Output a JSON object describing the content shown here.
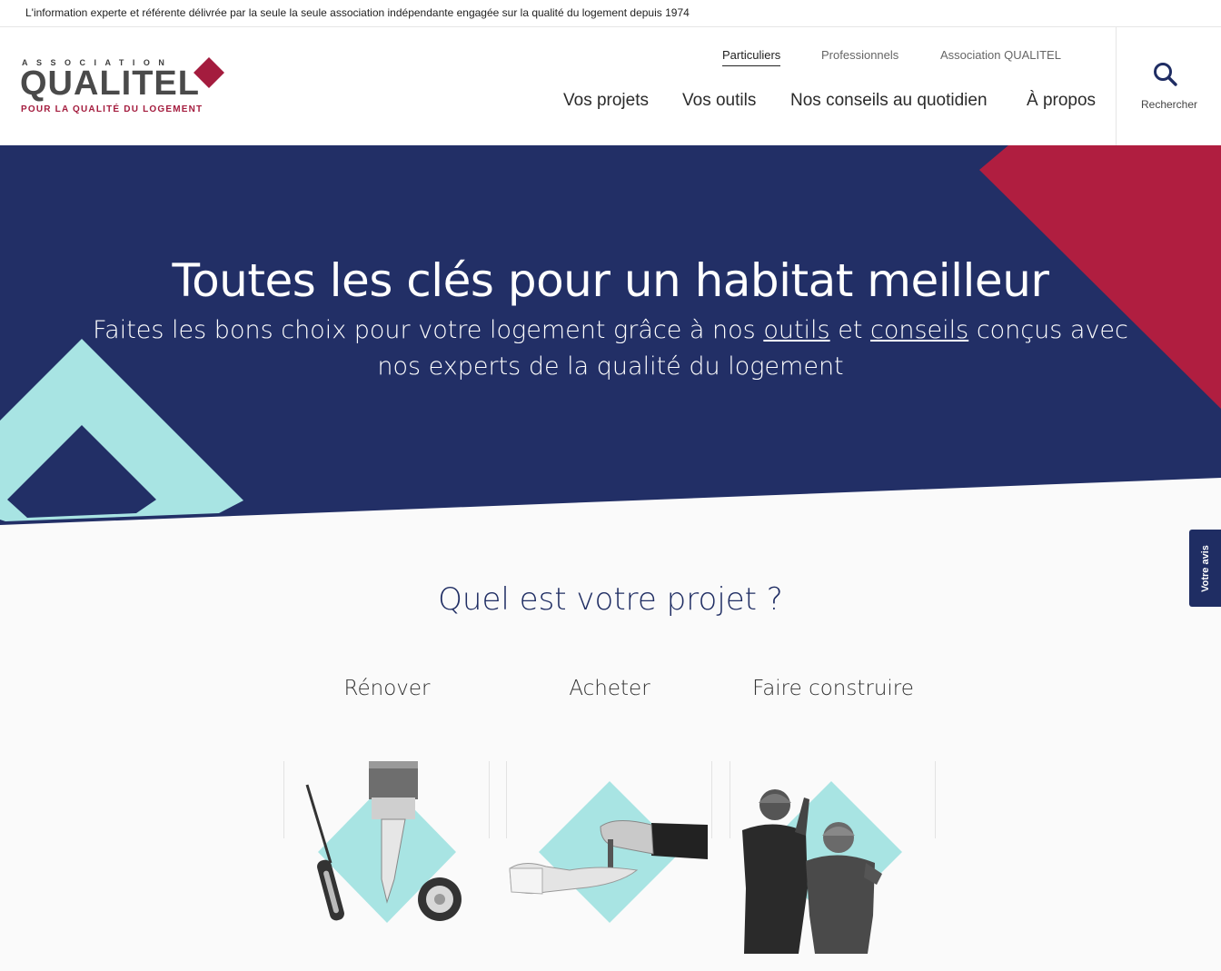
{
  "topbar": {
    "text": "L'information experte et référente délivrée par la seule la seule association indépendante engagée sur la qualité du logement depuis 1974"
  },
  "logo": {
    "assoc": "ASSOCIATION",
    "name": "QUALITEL",
    "tagline": "POUR LA QUALITÉ DU LOGEMENT",
    "accent": "#a41c3e"
  },
  "subnav": {
    "particuliers": "Particuliers",
    "professionnels": "Professionnels",
    "association": "Association QUALITEL"
  },
  "mainnav": {
    "projets": "Vos projets",
    "outils": "Vos outils",
    "conseils": "Nos conseils au quotidien",
    "apropos": "À propos"
  },
  "search": {
    "label": "Rechercher",
    "icon": "search-icon"
  },
  "hero": {
    "title": "Toutes les clés pour un habitat meilleur",
    "sub_before": "Faites les bons choix pour votre logement grâce à nos ",
    "link_outils": "outils",
    "sub_middle": " et ",
    "link_conseils": "conseils",
    "sub_after": " conçus avec nos experts de la qualité du logement",
    "colors": {
      "navy": "#222f66",
      "red": "#b01e40",
      "cyan": "#a8e4e3"
    }
  },
  "feedback": {
    "label": "Votre avis"
  },
  "projects": {
    "title": "Quel est votre projet ?",
    "items": [
      {
        "label": "Rénover",
        "icon": "paintbrush-tools-icon"
      },
      {
        "label": "Acheter",
        "icon": "key-handover-icon"
      },
      {
        "label": "Faire construire",
        "icon": "workers-icon"
      }
    ]
  }
}
